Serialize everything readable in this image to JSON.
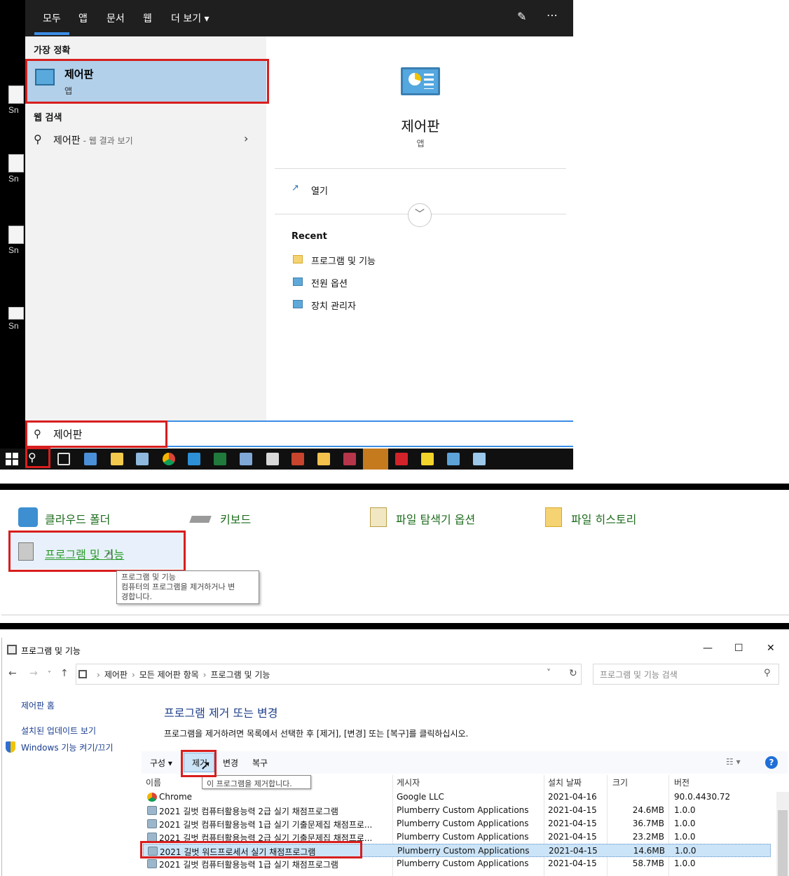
{
  "search": {
    "tabs": [
      "모두",
      "앱",
      "문서",
      "웹",
      "더 보기 ▾"
    ],
    "best_match_header": "가장 정확",
    "best_match": {
      "title": "제어판",
      "subtitle": "앱"
    },
    "web_header": "웹 검색",
    "web_item": {
      "text": "제어판",
      "sub": "- 웹 결과 보기"
    },
    "preview": {
      "title": "제어판",
      "subtitle": "앱",
      "open_label": "열기",
      "recent_header": "Recent",
      "recent": [
        {
          "label": "프로그램 및 기능",
          "icon": "folder-icon"
        },
        {
          "label": "전원 옵션",
          "icon": "control-panel-icon"
        },
        {
          "label": "장치 관리자",
          "icon": "control-panel-icon"
        }
      ]
    },
    "query": "제어판",
    "desktop_icon_label": "Sn"
  },
  "control_panel": {
    "items": [
      {
        "label": "클라우드 폴더",
        "icon": "cloud-folder-icon"
      },
      {
        "label": "키보드",
        "icon": "keyboard-icon"
      },
      {
        "label": "파일 탐색기 옵션",
        "icon": "file-explorer-options-icon"
      },
      {
        "label": "파일 히스토리",
        "icon": "file-history-icon"
      },
      {
        "label": "프로그램 및 기능",
        "icon": "programs-features-icon"
      }
    ],
    "tooltip": {
      "line1": "프로그램 및 기능",
      "line2": "컴퓨터의 프로그램을 제거하거나 변",
      "line3": "경합니다."
    }
  },
  "programs_window": {
    "title": "프로그램 및 기능",
    "breadcrumb": [
      "제어판",
      "모든 제어판 항목",
      "프로그램 및 기능"
    ],
    "search_placeholder": "프로그램 및 기능 검색",
    "left_links": [
      "제어판 홈",
      "설치된 업데이트 보기",
      "Windows 기능 켜기/끄기"
    ],
    "heading": "프로그램 제거 또는 변경",
    "description": "프로그램을 제거하려면 목록에서 선택한 후 [제거], [변경] 또는 [복구]를 클릭하십시오.",
    "commands": [
      "구성 ▾",
      "제거",
      "변경",
      "복구"
    ],
    "remove_tooltip": "이 프로그램을 제거합니다.",
    "columns": [
      "이름",
      "게시자",
      "설치 날짜",
      "크기",
      "버전"
    ],
    "rows": [
      {
        "name": "Chrome",
        "publisher": "Google LLC",
        "date": "2021-04-16",
        "size": "",
        "version": "90.0.4430.72",
        "icon": "chrome-icon"
      },
      {
        "name": "2021 길벗 컴퓨터활용능력 2급 실기 채점프로그램",
        "publisher": "Plumberry Custom Applications",
        "date": "2021-04-15",
        "size": "24.6MB",
        "version": "1.0.0",
        "icon": "setup-icon"
      },
      {
        "name": "2021 길벗 컴퓨터활용능력 1급 실기 기출문제집 채점프로...",
        "publisher": "Plumberry Custom Applications",
        "date": "2021-04-15",
        "size": "36.7MB",
        "version": "1.0.0",
        "icon": "setup-icon"
      },
      {
        "name": "2021 길벗 컴퓨터활용능력 2급 실기 기출문제집 채점프로...",
        "publisher": "Plumberry Custom Applications",
        "date": "2021-04-15",
        "size": "23.2MB",
        "version": "1.0.0",
        "icon": "setup-icon"
      },
      {
        "name": "2021 길벗 워드프로세서 실기 채점프로그램",
        "publisher": "Plumberry Custom Applications",
        "date": "2021-04-15",
        "size": "14.6MB",
        "version": "1.0.0",
        "icon": "setup-icon"
      },
      {
        "name": "2021 길벗 컴퓨터활용능력 1급 실기 채점프로그램",
        "publisher": "Plumberry Custom Applications",
        "date": "2021-04-15",
        "size": "58.7MB",
        "version": "1.0.0",
        "icon": "setup-icon"
      }
    ]
  },
  "colors": {
    "accent": "#3b8ee6",
    "highlight": "#d81e1e",
    "selection": "#cce4f7"
  }
}
